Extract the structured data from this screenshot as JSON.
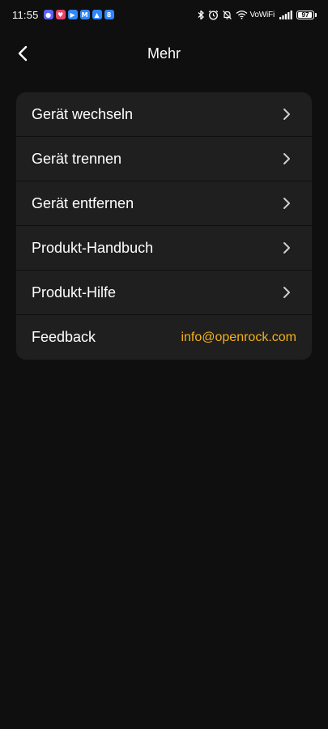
{
  "status_bar": {
    "time": "11:55",
    "network_label": "VoWiFi",
    "battery_level": "97",
    "battery_fraction": 0.97,
    "notification_icons": [
      {
        "name": "discord-icon",
        "color": "#5865f2",
        "glyph": "●"
      },
      {
        "name": "heart-app-icon",
        "color": "#e8456b",
        "glyph": "♥"
      },
      {
        "name": "youtube-icon",
        "color": "#2f86ff",
        "glyph": "▶"
      },
      {
        "name": "gmail-icon",
        "color": "#2f86ff",
        "glyph": "M"
      },
      {
        "name": "drive-icon",
        "color": "#2f86ff",
        "glyph": "▲"
      },
      {
        "name": "app-8-icon",
        "color": "#2f86ff",
        "glyph": "8"
      }
    ]
  },
  "header": {
    "title": "Mehr",
    "back_icon": "chevron-left-icon"
  },
  "menu": {
    "items": [
      {
        "label": "Gerät wechseln",
        "icon": "chevron-right-icon"
      },
      {
        "label": "Gerät trennen",
        "icon": "chevron-right-icon"
      },
      {
        "label": "Gerät entfernen",
        "icon": "chevron-right-icon"
      },
      {
        "label": "Produkt-Handbuch",
        "icon": "chevron-right-icon"
      },
      {
        "label": "Produkt-Hilfe",
        "icon": "chevron-right-icon"
      }
    ],
    "feedback": {
      "label": "Feedback",
      "email": "info@openrock.com"
    }
  },
  "colors": {
    "background": "#0f0f0f",
    "card": "#1f1f1f",
    "text": "#ffffff",
    "accent": "#f2b21a",
    "chevron": "#cfcfcf"
  }
}
